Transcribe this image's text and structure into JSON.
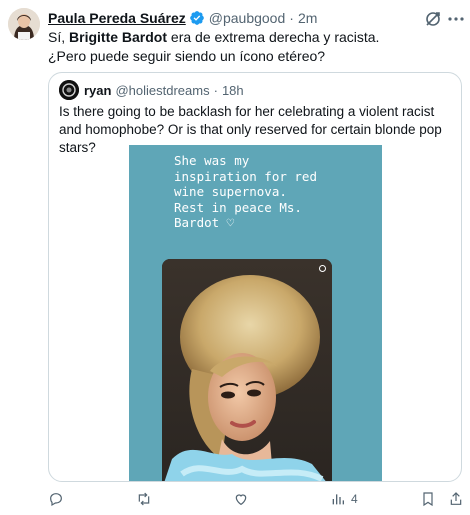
{
  "tweet": {
    "author_name": "Paula Pereda Suárez",
    "handle": "@paubgood",
    "separator": "·",
    "time": "2m",
    "body": {
      "line1_pre": "Sí, ",
      "line1_bold": "Brigitte Bardot",
      "line1_post": " era de extrema derecha y racista.",
      "line2": "¿Pero puede seguir siendo un ícono etéreo?"
    }
  },
  "quoted": {
    "author_name": "ryan",
    "handle": "@holiestdreams",
    "separator": "·",
    "time": "18h",
    "text": "Is there going to be backlash for her celebrating a violent racist and homophobe? Or is that only reserved for certain blonde pop stars?",
    "media_caption": "She was my\ninspiration for red\nwine supernova.\nRest in peace Ms.\nBardot ♡",
    "media_bg": "#5fa6b7"
  },
  "actions": {
    "reply_count": "",
    "retweet_count": "",
    "like_count": "",
    "views_count": "4"
  },
  "colors": {
    "text": "#0f1419",
    "secondary": "#536471",
    "border": "#cfd9de",
    "verified": "#1d9bf0"
  },
  "icons": [
    "verified-badge-icon",
    "grok-icon",
    "more-icon",
    "reply-icon",
    "retweet-icon",
    "like-icon",
    "views-icon",
    "bookmark-icon",
    "share-icon"
  ]
}
